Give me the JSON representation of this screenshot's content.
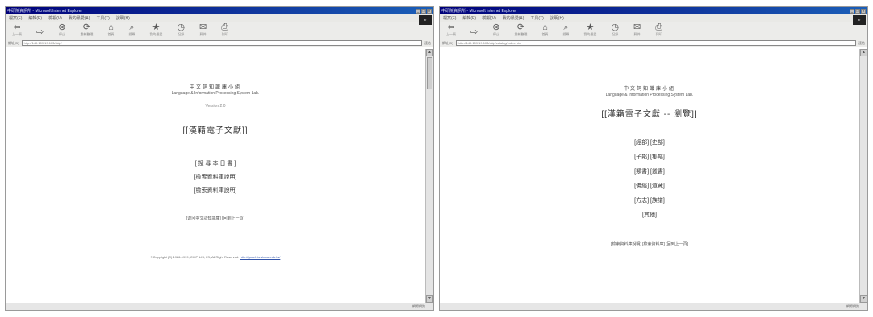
{
  "windows": [
    {
      "titlebar": {
        "title": "中研院資訊所 - Microsoft Internet Explorer"
      },
      "menubar": {
        "items": [
          "檔案(F)",
          "編輯(E)",
          "檢視(V)",
          "我的最愛(A)",
          "工具(T)",
          "說明(H)"
        ],
        "logo": "e"
      },
      "toolbar": {
        "buttons": [
          {
            "glyph": "⇦",
            "caption": "上一頁"
          },
          {
            "glyph": "⇨",
            "caption": ""
          },
          {
            "glyph": "⊗",
            "caption": "停止"
          },
          {
            "glyph": "⟳",
            "caption": "重新整理"
          },
          {
            "glyph": "⌂",
            "caption": "首頁"
          },
          {
            "glyph": "⌕",
            "caption": "搜尋"
          },
          {
            "glyph": "★",
            "caption": "我的最愛"
          },
          {
            "glyph": "◷",
            "caption": "記錄"
          },
          {
            "glyph": "✉",
            "caption": "郵件"
          },
          {
            "glyph": "⎙",
            "caption": "列印"
          }
        ]
      },
      "addressbar": {
        "label": "網址(D)",
        "url": "http://140.109.19.103/ckip/",
        "go_label": "連結"
      },
      "content": {
        "lab_name": "中文詞知識庫小組",
        "lab_en": "Language & Information Processing System Lab.",
        "version": "Version 2.0",
        "main_title": "[[漢籍電子文獻]]",
        "links": [
          "[ 搜 尋 本 日 書 ]",
          "[檢索資料庫說明]",
          "[檢索資料庫說明]"
        ],
        "small_links": "[返回中文詞知識庫]  [回到上一頁]",
        "footer_text": "©Copyright (C) 1986-1999, CKIP, LIS, IIS, All Right Reserved.",
        "footer_link": "http://godel.iis.sinica.edu.tw/"
      },
      "statusbar": {
        "text": "網際網路"
      }
    },
    {
      "titlebar": {
        "title": "中研院資訊所 - Microsoft Internet Explorer"
      },
      "menubar": {
        "items": [
          "檔案(F)",
          "編輯(E)",
          "檢視(V)",
          "我的最愛(A)",
          "工具(T)",
          "說明(H)"
        ],
        "logo": "e"
      },
      "toolbar": {
        "buttons": [
          {
            "glyph": "⇦",
            "caption": "上一頁"
          },
          {
            "glyph": "⇨",
            "caption": ""
          },
          {
            "glyph": "⊗",
            "caption": "停止"
          },
          {
            "glyph": "⟳",
            "caption": "重新整理"
          },
          {
            "glyph": "⌂",
            "caption": "首頁"
          },
          {
            "glyph": "⌕",
            "caption": "搜尋"
          },
          {
            "glyph": "★",
            "caption": "我的最愛"
          },
          {
            "glyph": "◷",
            "caption": "記錄"
          },
          {
            "glyph": "✉",
            "caption": "郵件"
          },
          {
            "glyph": "⎙",
            "caption": "列印"
          }
        ]
      },
      "addressbar": {
        "label": "網址(D)",
        "url": "http://140.109.19.103/ckip/catalog/index.htm",
        "go_label": "連結"
      },
      "content": {
        "lab_name": "中文詞知識庫小組",
        "lab_en": "Language & Information Processing System Lab.",
        "main_title": "[[漢籍電子文獻 -- 瀏覽]]",
        "links": [
          "[經部] [史部]",
          "[子部] [集部]",
          "[類書] [叢書]",
          "[佛經] [道藏]",
          "[方志] [族譜]",
          "[其他]"
        ],
        "bottom_links": "[檢索資料庫說明]  [檢索資料庫]  [回到上一頁]"
      },
      "statusbar": {
        "text": "網際網路"
      }
    }
  ]
}
